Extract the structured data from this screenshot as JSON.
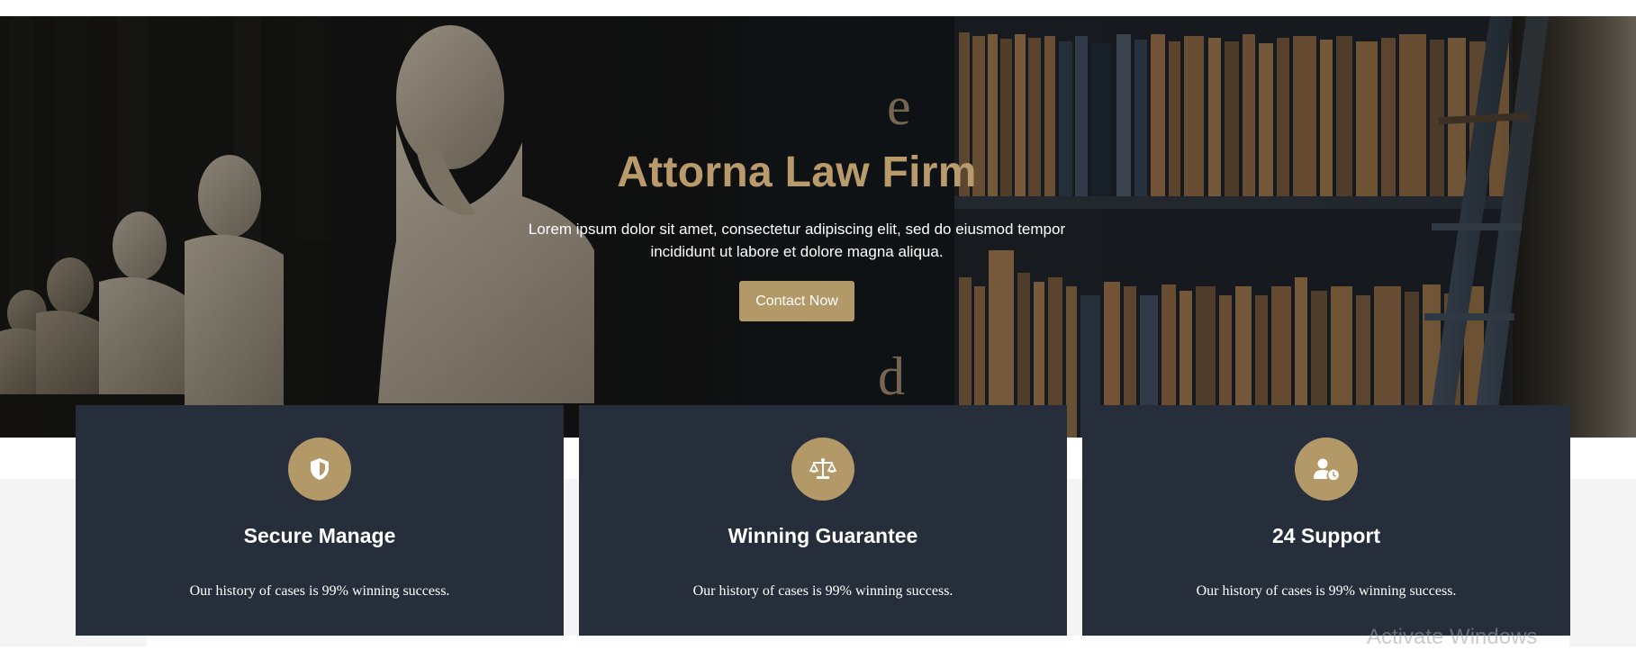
{
  "hero": {
    "title": "Attorna Law Firm",
    "description": "Lorem ipsum dolor sit amet, consectetur adipiscing elit, sed do eiusmod tempor incididunt ut labore et dolore magna aliqua.",
    "cta_label": "Contact Now",
    "bg_letters": [
      "e",
      "d"
    ]
  },
  "features": [
    {
      "icon": "shield-icon",
      "title": "Secure Manage",
      "text": "Our history of cases is 99% winning success."
    },
    {
      "icon": "scales-icon",
      "title": "Winning Guarantee",
      "text": "Our history of cases is 99% winning success."
    },
    {
      "icon": "user-clock-icon",
      "title": "24 Support",
      "text": "Our history of cases is 99% winning success."
    }
  ],
  "watermark": "Activate Windows",
  "colors": {
    "accent": "#b39868",
    "title_gold": "#b99b6b",
    "card_bg": "#262d3b",
    "section_bg": "#f4f4f4"
  }
}
